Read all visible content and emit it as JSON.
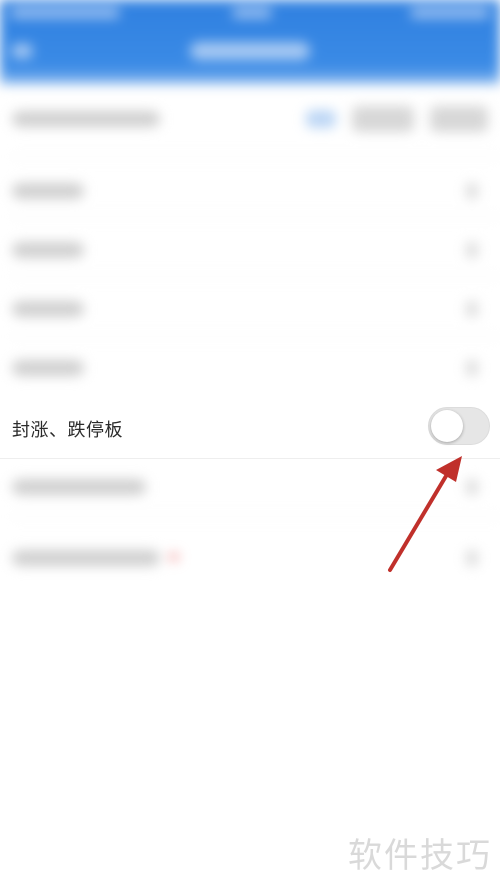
{
  "setting_row": {
    "label": "封涨、跌停板",
    "toggle_on": false
  },
  "watermark": "软件技巧",
  "colors": {
    "header_blue": "#2f80e0",
    "arrow_red": "#c0302b",
    "toggle_off": "#e6e6e6"
  }
}
